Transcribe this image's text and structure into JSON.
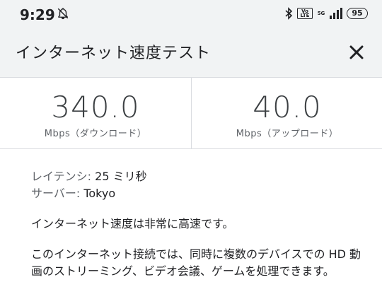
{
  "status_bar": {
    "time": "9:29",
    "volte_label": "Vo LTE",
    "network_label": "5G",
    "battery": "95"
  },
  "header": {
    "title": "インターネット速度テスト"
  },
  "results": {
    "download": {
      "value": "340.0",
      "unit": "Mbps（ダウンロード）"
    },
    "upload": {
      "value": "40.0",
      "unit": "Mbps（アップロード）"
    }
  },
  "details": {
    "latency_label": "レイテンシ:",
    "latency_value": "25 ミリ秒",
    "server_label": "サーバー:",
    "server_value": "Tokyo"
  },
  "summary": "インターネット速度は非常に高速です。",
  "description": "このインターネット接続では、同時に複数のデバイスでの HD 動画のストリーミング、ビデオ会議、ゲームを処理できます。",
  "colors": {
    "header_bg": "#f1f3f4",
    "text": "#202124",
    "secondary_text": "#5f6368"
  },
  "icons": [
    "bell-off-icon",
    "bluetooth-icon",
    "signal-icon",
    "battery-icon",
    "close-icon"
  ]
}
